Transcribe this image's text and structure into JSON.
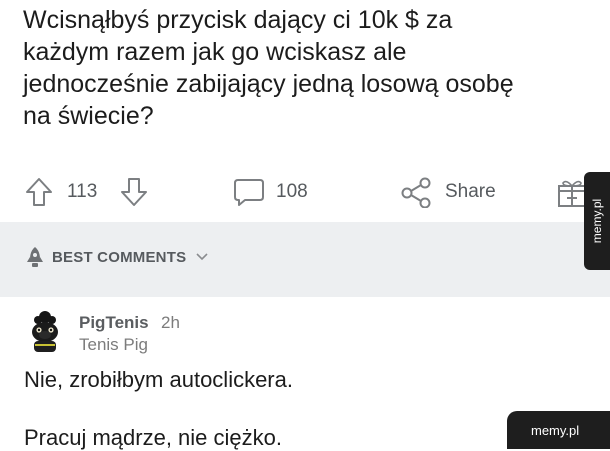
{
  "post": {
    "title": "Wcisnąłbyś przycisk dający ci 10k $ za\nkażdym razem jak go wciskasz ale\njednocześnie zabijający jedną losową osobę\nna świecie?"
  },
  "actions": {
    "upvotes": "113",
    "comments": "108",
    "share_label": "Share"
  },
  "sort": {
    "label": "BEST COMMENTS"
  },
  "comment": {
    "username": "PigTenis",
    "time": "2h",
    "flair": "Tenis Pig",
    "lines": [
      "Nie, zrobiłbym autoclickera.",
      "Pracuj mądrze, nie ciężko."
    ]
  },
  "watermarks": {
    "side": "memy.pl",
    "bottom": "memy.pl"
  },
  "icons": [
    "upvote-arrow-icon",
    "downvote-arrow-icon",
    "comment-bubble-icon",
    "share-icon",
    "gift-icon",
    "rocket-icon",
    "chevron-down-icon"
  ]
}
